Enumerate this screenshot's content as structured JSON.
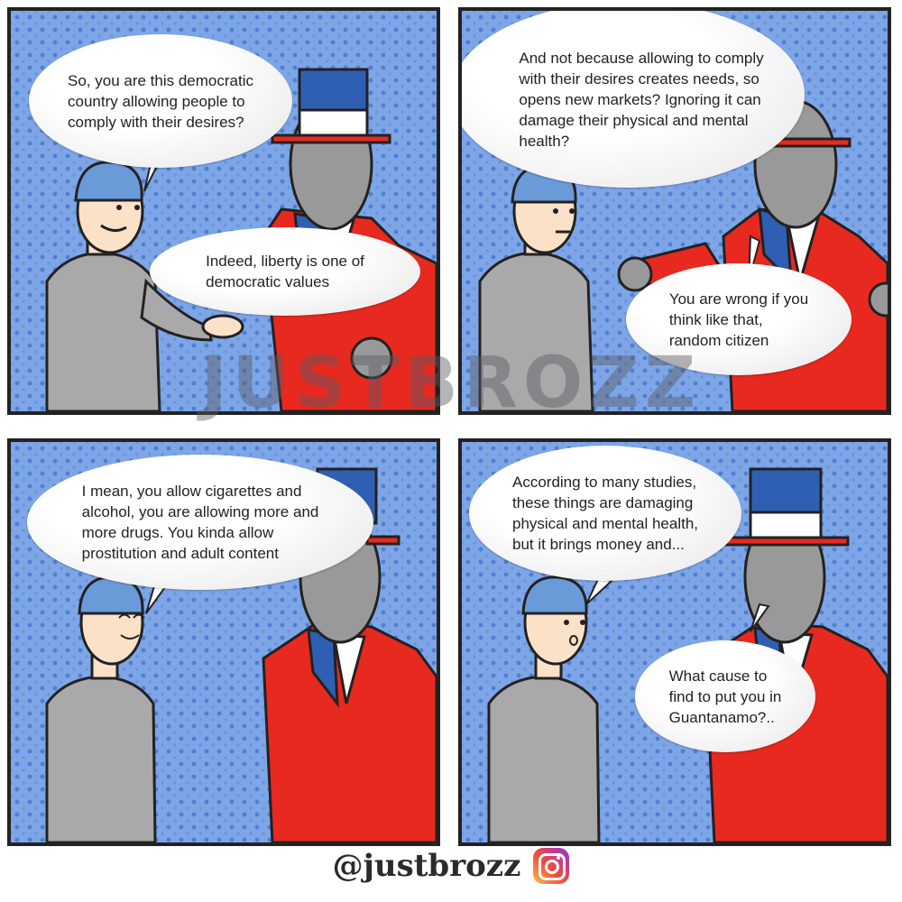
{
  "panels": [
    {
      "bubble_top": "So, you are this democratic\ncountry allowing people to\ncomply with their desires?",
      "bubble_bottom": "Indeed, liberty is one of\ndemocratic values"
    },
    {
      "bubble_top": "And not because allowing to comply\nwith their desires creates needs, so\nopens new markets? Ignoring it can\ndamage their physical and mental\nhealth?",
      "bubble_bottom": "You are wrong if you\nthink like that,\nrandom citizen"
    },
    {
      "bubble_top": "I mean, you allow cigarettes and\nalcohol, you are allowing more and\nmore drugs. You kinda allow\nprostitution and adult content"
    },
    {
      "bubble_top": "According to many studies,\nthese things are damaging\nphysical and mental health,\nbut it brings money and...",
      "bubble_bottom": "What cause to\nfind to put you in\nGuantanamo?.."
    }
  ],
  "watermark": "JUSTBROZZ",
  "footer": {
    "handle": "@justbrozz",
    "icon": "instagram-icon"
  },
  "colors": {
    "panel_bg": "#7ea6e6",
    "suit": "#e8291f",
    "hat_blue": "#2f5fb3",
    "shirt": "#a9a9a9",
    "cap": "#6a9ad8"
  }
}
